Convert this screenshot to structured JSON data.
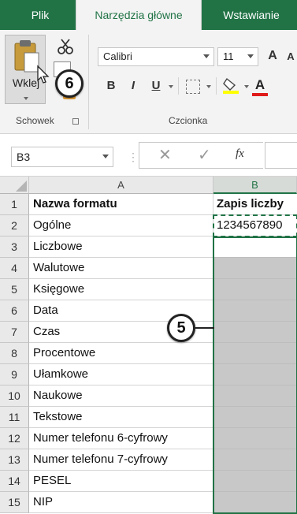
{
  "ribbon_tabs": {
    "file": "Plik",
    "home": "Narzędzia główne",
    "insert": "Wstawianie"
  },
  "clipboard": {
    "paste_label": "Wklej",
    "group_label": "Schowek"
  },
  "font": {
    "name": "Calibri",
    "size": "11",
    "group_label": "Czcionka",
    "bold": "B",
    "italic": "I",
    "underline": "U",
    "grow": "A",
    "font_color": "A"
  },
  "formula_bar": {
    "name_box": "B3",
    "fx": "fx"
  },
  "columns": [
    "A",
    "B"
  ],
  "rows": [
    {
      "n": "1",
      "a": "Nazwa formatu",
      "b": "Zapis liczby"
    },
    {
      "n": "2",
      "a": "Ogólne",
      "b": "1234567890"
    },
    {
      "n": "3",
      "a": "Liczbowe",
      "b": ""
    },
    {
      "n": "4",
      "a": "Walutowe",
      "b": ""
    },
    {
      "n": "5",
      "a": "Księgowe",
      "b": ""
    },
    {
      "n": "6",
      "a": "Data",
      "b": ""
    },
    {
      "n": "7",
      "a": "Czas",
      "b": ""
    },
    {
      "n": "8",
      "a": "Procentowe",
      "b": ""
    },
    {
      "n": "9",
      "a": "Ułamkowe",
      "b": ""
    },
    {
      "n": "10",
      "a": "Naukowe",
      "b": ""
    },
    {
      "n": "11",
      "a": "Tekstowe",
      "b": ""
    },
    {
      "n": "12",
      "a": "Numer telefonu 6-cyfrowy",
      "b": ""
    },
    {
      "n": "13",
      "a": "Numer telefonu 7-cyfrowy",
      "b": ""
    },
    {
      "n": "14",
      "a": "PESEL",
      "b": ""
    },
    {
      "n": "15",
      "a": "NIP",
      "b": ""
    }
  ],
  "callouts": {
    "paste_step": "6",
    "range_step": "5"
  },
  "colors": {
    "excel_green": "#217346",
    "selection_fill": "#c8c8c8"
  }
}
